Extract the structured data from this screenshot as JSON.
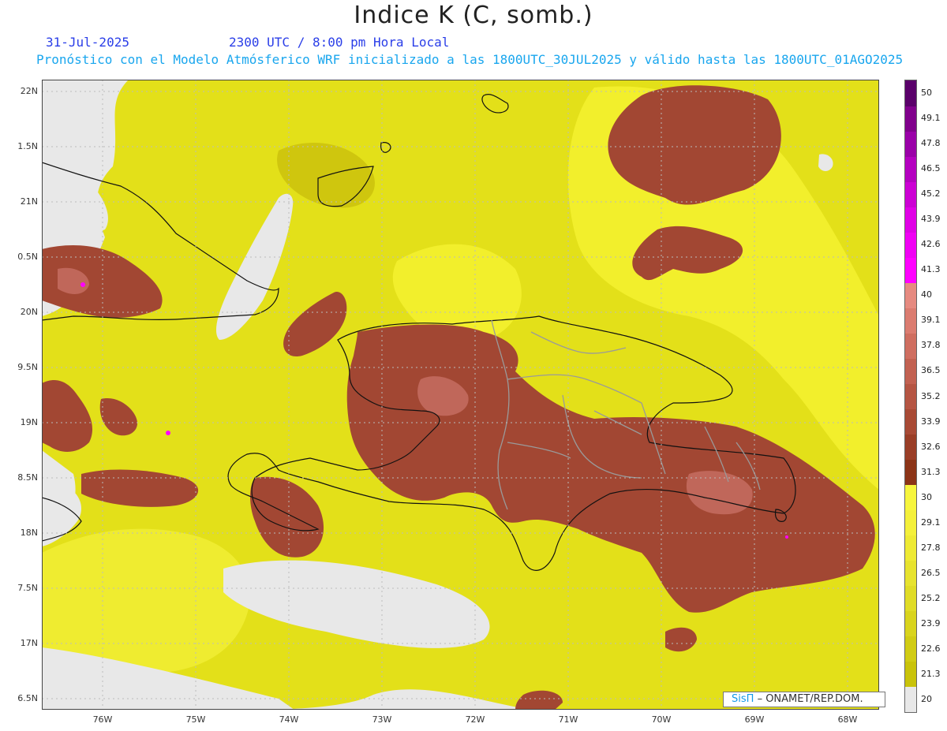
{
  "header": {
    "title": "Indice K (C, somb.)",
    "valid_date": "31-Jul-2025",
    "valid_time": "2300 UTC / 8:00 pm Hora Local",
    "forecast_info": "Pronóstico con el Modelo Atmósferico WRF inicializado a las 1800UTC_30JUL2025 y válido hasta las  1800UTC_01AGO2025"
  },
  "axes": {
    "lat_labels": [
      "22N",
      "1.5N",
      "21N",
      "0.5N",
      "20N",
      "9.5N",
      "19N",
      "8.5N",
      "18N",
      "7.5N",
      "17N",
      "6.5N"
    ],
    "lon_labels": [
      "76W",
      "75W",
      "74W",
      "73W",
      "72W",
      "71W",
      "70W",
      "69W",
      "68W"
    ]
  },
  "legend": {
    "labels": [
      "20",
      "21.3",
      "22.6",
      "23.9",
      "25.2",
      "26.5",
      "27.8",
      "29.1",
      "30",
      "31.3",
      "32.6",
      "33.9",
      "35.2",
      "36.5",
      "37.8",
      "39.1",
      "40",
      "41.3",
      "42.6",
      "43.9",
      "45.2",
      "46.5",
      "47.8",
      "49.1",
      "50"
    ],
    "colors": [
      "#e8e8e8",
      "#c9c30a",
      "#d1cc14",
      "#d9d41d",
      "#e0dc26",
      "#e7e32e",
      "#eeea34",
      "#f4f03a",
      "#f7f53d",
      "#8c3417",
      "#9a3e27",
      "#a84a35",
      "#b55543",
      "#c26151",
      "#cf6e60",
      "#db7c70",
      "#e68a80",
      "#ff00ff",
      "#f000f4",
      "#e000e6",
      "#cc00d4",
      "#b400c0",
      "#9a00a8",
      "#80008c",
      "#5a006a"
    ]
  },
  "credit": {
    "logo": "SisΠ",
    "text": "– ONAMET/REP.DOM."
  }
}
